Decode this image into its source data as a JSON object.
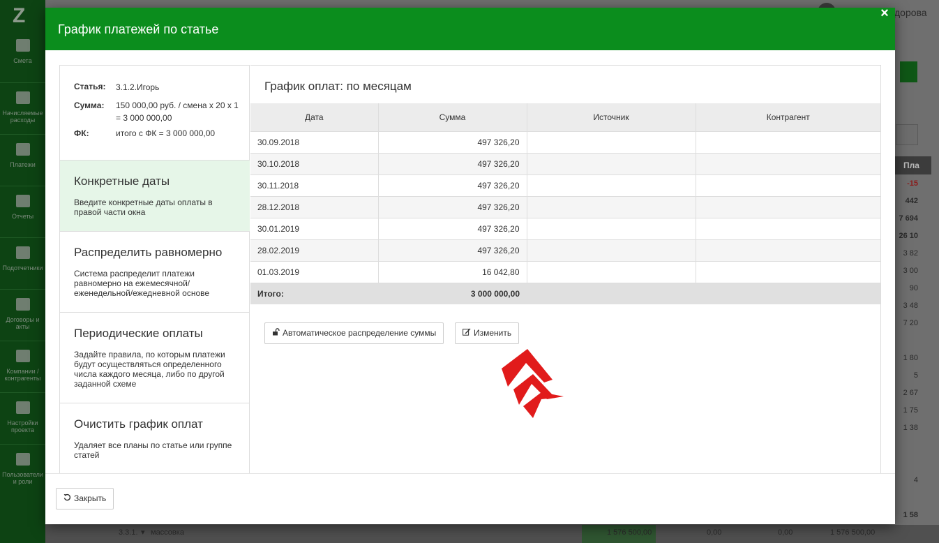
{
  "background": {
    "logo": "Z",
    "user_name": "дорова",
    "nav": [
      {
        "label": "Смета",
        "icon": "book-icon"
      },
      {
        "label": "Начисляемые расходы",
        "icon": "calendar-icon"
      },
      {
        "label": "Платежи",
        "icon": "card-icon"
      },
      {
        "label": "Отчеты",
        "icon": "bar-chart-icon"
      },
      {
        "label": "Подотчетники",
        "icon": "briefcase-icon"
      },
      {
        "label": "Договоры и акты",
        "icon": "list-icon"
      },
      {
        "label": "Компании / контрагенты",
        "icon": "person-icon"
      },
      {
        "label": "Настройки проекта",
        "icon": "sliders-icon"
      },
      {
        "label": "Пользователи и роли",
        "icon": "users-icon"
      }
    ],
    "col_header": "Пла",
    "values": [
      "-15",
      "442",
      "7 694",
      "26 10",
      "3 82",
      "3 00",
      "90",
      "3 48",
      "7 20",
      "1 80",
      "5",
      "2 67",
      "1 75",
      "1 38",
      "4",
      "1 58"
    ],
    "bottom_row": {
      "code": "3.3.1.",
      "name": "массовка",
      "v1": "1 576 500,00",
      "v2": "0,00",
      "v3": "0,00",
      "v4": "1 576 500,00"
    }
  },
  "modal": {
    "title": "График платежей по статье",
    "close_icon": "×",
    "info": {
      "article_label": "Статья:",
      "article_value": "3.1.2.Игорь",
      "sum_label": "Сумма:",
      "sum_value": "150 000,00 руб. / смена x 20 x 1 = 3 000 000,00",
      "fk_label": "ФК:",
      "fk_value": "итого с ФК = 3 000 000,00"
    },
    "options": [
      {
        "title": "Конкретные даты",
        "desc": "Введите конкретные даты оплаты в правой части окна",
        "active": true
      },
      {
        "title": "Распределить равномерно",
        "desc": "Система распределит платежи равномерно на ежемесячной/ еженедельной/ежедневной основе",
        "active": false
      },
      {
        "title": "Периодические оплаты",
        "desc": "Задайте правила, по которым платежи будут осуществляться определенного числа каждого месяца, либо по другой заданной схеме",
        "active": false
      },
      {
        "title": "Очистить график оплат",
        "desc": "Удаляет все планы по статье или группе статей",
        "active": false
      }
    ],
    "schedule": {
      "title": "График оплат: по месяцам",
      "columns": [
        "Дата",
        "Сумма",
        "Источник",
        "Контрагент"
      ],
      "rows": [
        {
          "date": "30.09.2018",
          "sum": "497 326,20",
          "source": "",
          "counterparty": ""
        },
        {
          "date": "30.10.2018",
          "sum": "497 326,20",
          "source": "",
          "counterparty": ""
        },
        {
          "date": "30.11.2018",
          "sum": "497 326,20",
          "source": "",
          "counterparty": ""
        },
        {
          "date": "28.12.2018",
          "sum": "497 326,20",
          "source": "",
          "counterparty": ""
        },
        {
          "date": "30.01.2019",
          "sum": "497 326,20",
          "source": "",
          "counterparty": ""
        },
        {
          "date": "28.02.2019",
          "sum": "497 326,20",
          "source": "",
          "counterparty": ""
        },
        {
          "date": "01.03.2019",
          "sum": "16 042,80",
          "source": "",
          "counterparty": ""
        }
      ],
      "total_label": "Итого:",
      "total_value": "3 000 000,00"
    },
    "buttons": {
      "auto_distribute": "Автоматическое распределение суммы",
      "edit": "Изменить",
      "close": "Закрыть"
    },
    "accent_color": "#0b8d1d"
  }
}
